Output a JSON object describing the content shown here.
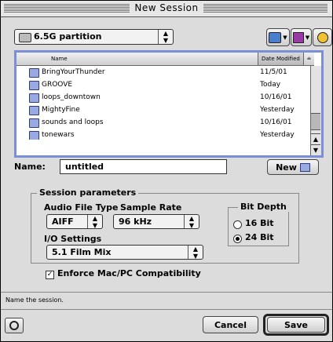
{
  "window": {
    "title": "New Session"
  },
  "location": {
    "volume": "6.5G partition",
    "tools": [
      {
        "icon": "desktop-icon"
      },
      {
        "icon": "shortcuts-icon"
      },
      {
        "icon": "recent-icon"
      }
    ]
  },
  "file_list": {
    "columns": {
      "name": "Name",
      "date": "Date Modified"
    },
    "rows": [
      {
        "name": "BringYourThunder",
        "date": "11/5/01"
      },
      {
        "name": "GROOVE",
        "date": "Today"
      },
      {
        "name": "loops_downtown",
        "date": "10/16/01"
      },
      {
        "name": "MightyFine",
        "date": "Yesterday"
      },
      {
        "name": "sounds and loops",
        "date": "10/16/01"
      },
      {
        "name": "tonewars",
        "date": "Yesterday"
      }
    ]
  },
  "name_field": {
    "label": "Name:",
    "value": "untitled"
  },
  "new_folder_button": {
    "label": "New"
  },
  "session": {
    "title": "Session parameters",
    "audio_file_type": {
      "label": "Audio File Type",
      "value": "AIFF"
    },
    "sample_rate": {
      "label": "Sample Rate",
      "value": "96 kHz"
    },
    "io_settings": {
      "label": "I/O Settings",
      "value": "5.1 Film Mix"
    },
    "bit_depth": {
      "title": "Bit Depth",
      "options": [
        {
          "label": "16 Bit",
          "selected": false
        },
        {
          "label": "24 Bit",
          "selected": true
        }
      ]
    },
    "compat": {
      "label": "Enforce Mac/PC Compatibility",
      "checked": true
    }
  },
  "status": {
    "text": "Name the session."
  },
  "buttons": {
    "cancel": "Cancel",
    "save": "Save"
  }
}
